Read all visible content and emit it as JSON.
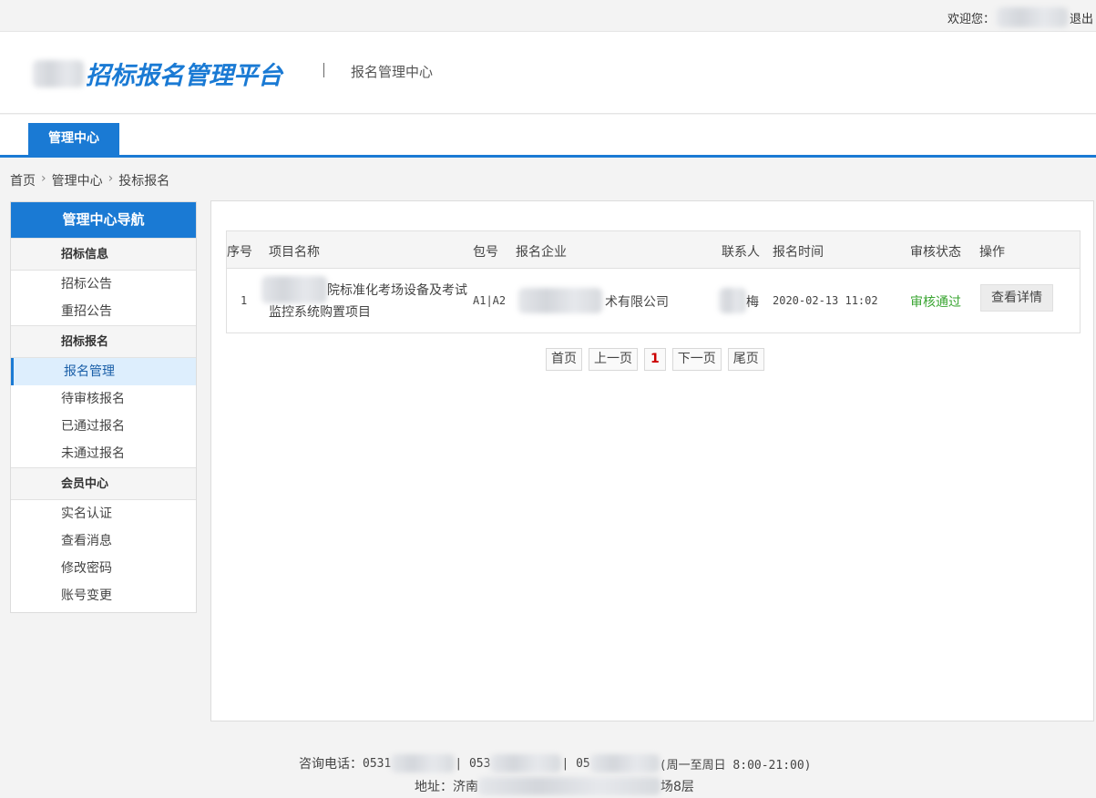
{
  "topbar": {
    "welcome_label": "欢迎您：",
    "logout": "退出"
  },
  "header": {
    "logo_text": "招标报名管理平台",
    "subtitle": "报名管理中心"
  },
  "nav": {
    "tab": "管理中心"
  },
  "breadcrumb": [
    "首页",
    "管理中心",
    "投标报名"
  ],
  "breadcrumb_sep": "›",
  "sidebar": {
    "title": "管理中心导航",
    "groups": [
      {
        "label": "招标信息",
        "items": [
          "招标公告",
          "重招公告"
        ]
      },
      {
        "label": "招标报名",
        "items": [
          "报名管理",
          "待审核报名",
          "已通过报名",
          "未通过报名"
        ]
      },
      {
        "label": "会员中心",
        "items": [
          "实名认证",
          "查看消息",
          "修改密码",
          "账号变更"
        ]
      }
    ],
    "active_item": "报名管理"
  },
  "table": {
    "headers": [
      "序号",
      "项目名称",
      "包号",
      "报名企业",
      "联系人",
      "报名时间",
      "审核状态",
      "操作"
    ],
    "rows": [
      {
        "index": "1",
        "project_line1": "院标准化考场设备及考试",
        "project_line2": "监控系统购置项目",
        "package": "A1|A2",
        "company": "术有限公司",
        "contact": "梅",
        "time": "2020-02-13 11:02",
        "status": "审核通过",
        "action": "查看详情"
      }
    ]
  },
  "pager": {
    "first": "首页",
    "prev": "上一页",
    "current": "1",
    "next": "下一页",
    "last": "尾页"
  },
  "footer": {
    "phone_label": "咨询电话：",
    "phone1": "0531",
    "phone2": "| 053",
    "phone3": "| 05",
    "hours": "(周一至周日 8:00-21:00)",
    "address_label": "地址：济南",
    "address_tail": "场8层"
  },
  "colors": {
    "brand": "#1a7ad4",
    "status_ok": "#3aa532",
    "pager_current": "#cc0000"
  }
}
